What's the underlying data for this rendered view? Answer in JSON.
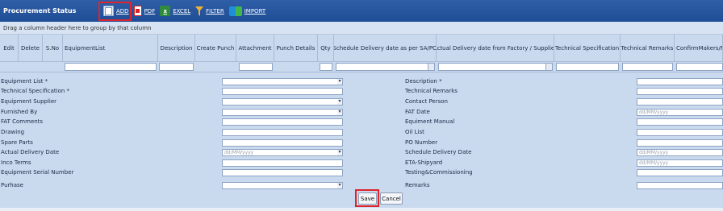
{
  "toolbar": {
    "title": "Procurement Status",
    "add_label": "ADD",
    "pdf_label": "PDF",
    "excel_label": "EXCEL",
    "filter_label": "FILTER",
    "import_label": "IMPORT"
  },
  "group_hint": "Drag a column header here to group by that column",
  "columns": [
    "Edit",
    "Delete",
    "S.No",
    "EquipmentList",
    "Description",
    "Create Punch",
    "Attachment",
    "Punch Details",
    "Qty",
    "Schedule Delivery date as per SA/PO",
    "Actual Delivery date from Factory / Supplier",
    "Technical Specification",
    "Technical Remarks",
    "ConfirmMakers/M"
  ],
  "form": {
    "left_labels": [
      "Equipment List *",
      "Technical Specification *",
      "Equipment Supplier",
      "Furnished By",
      "FAT Comments",
      "Drawing",
      "Spare Parts",
      "Actual Delivery Date",
      "Inco Terms",
      "Equipment Serial Number",
      "Purhase"
    ],
    "right_labels": [
      "Description *",
      "Technical Remarks",
      "Contact Person",
      "FAT Date",
      "Equiment Manual",
      "Oil List",
      "PO Number",
      "Schedule Delivery Date",
      "ETA-Shipyard",
      "Testing&Commissioning",
      "Remarks"
    ],
    "date_placeholder": "dd/MM/yyyy",
    "save_label": "Save",
    "cancel_label": "Cancel"
  },
  "colors": {
    "header_blue": "#1f4d95",
    "panel_blue": "#c9d9ee",
    "highlight_red": "#e0242b"
  }
}
